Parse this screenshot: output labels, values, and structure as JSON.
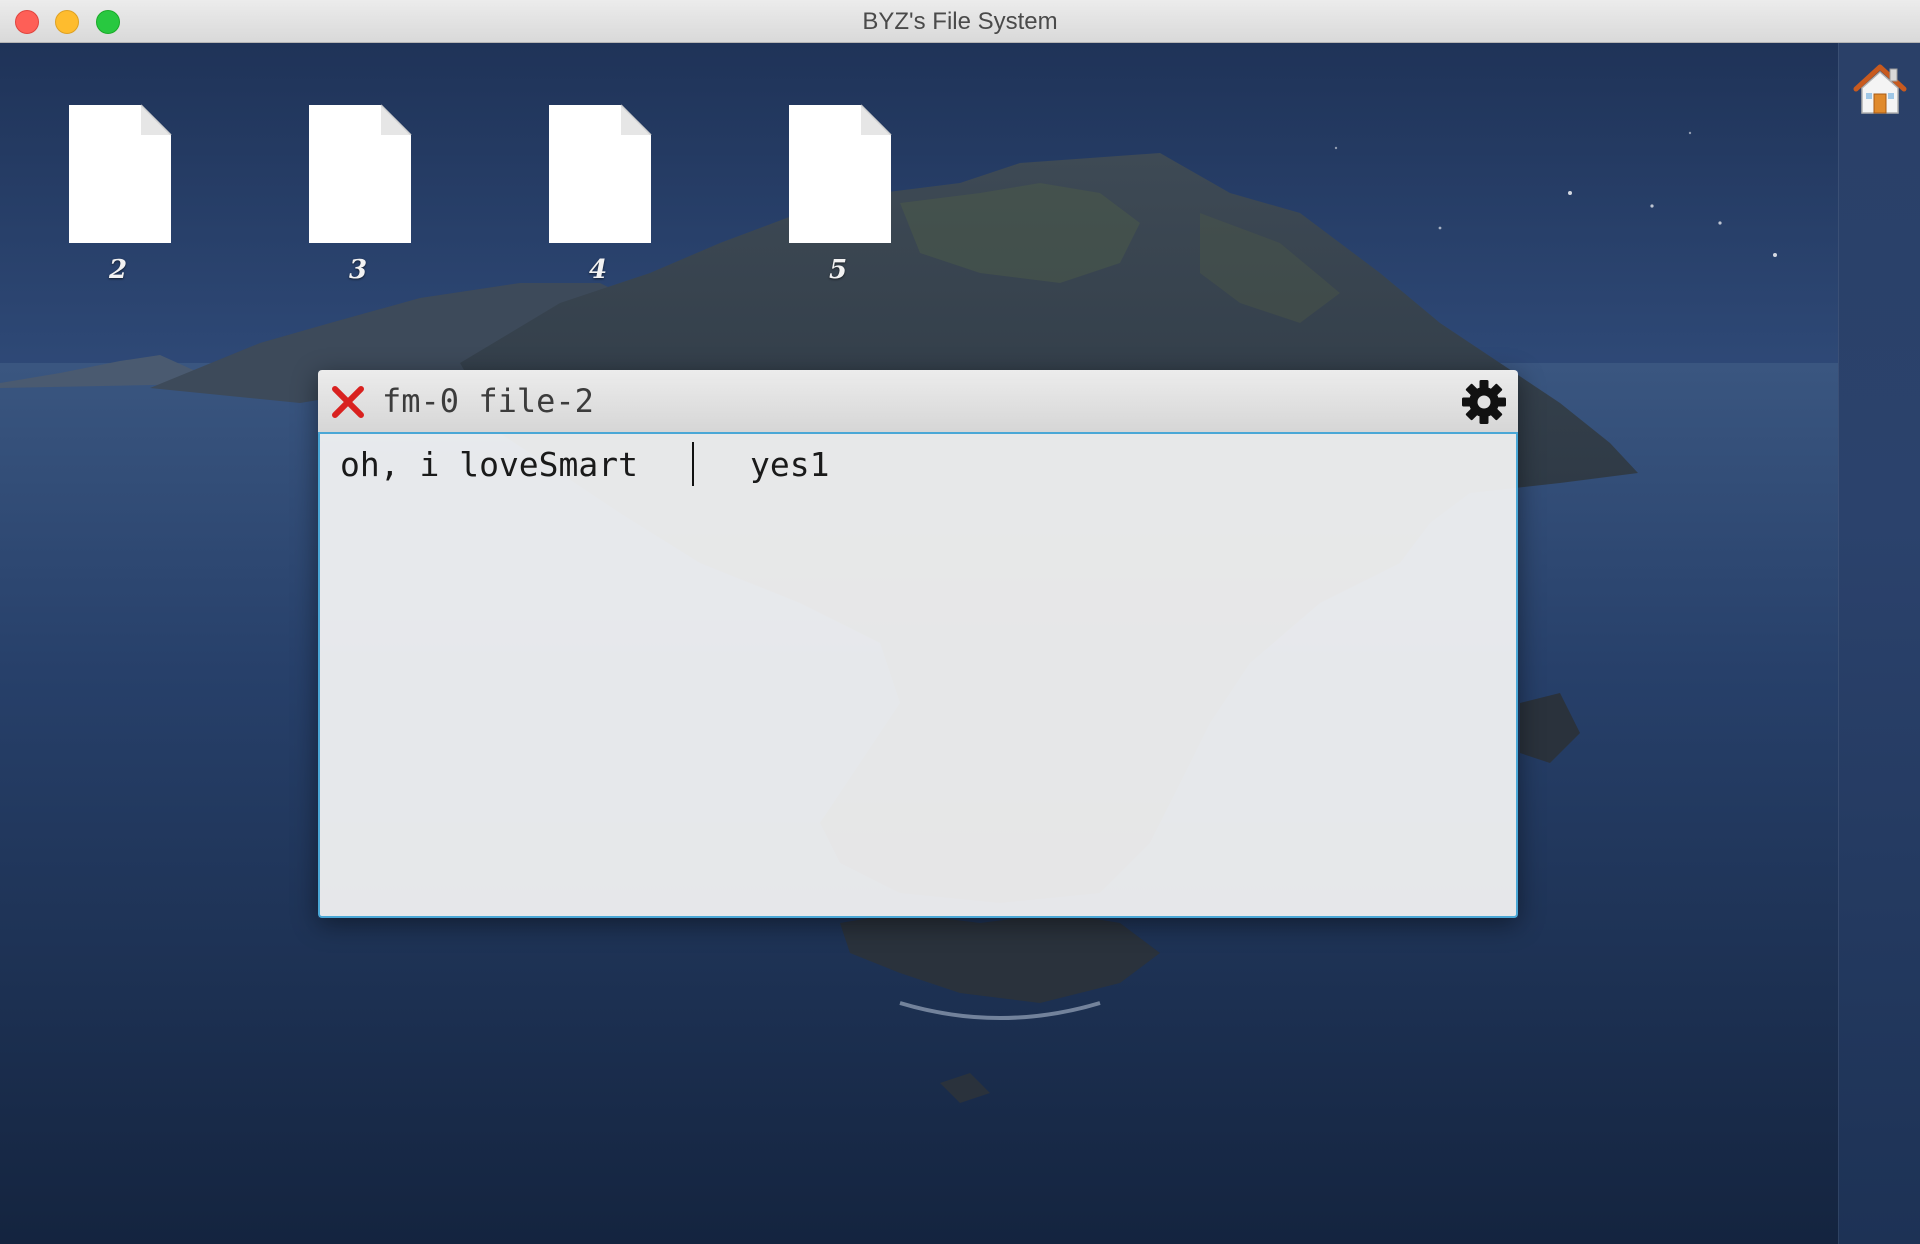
{
  "app": {
    "title": "BYZ's File System"
  },
  "desktop": {
    "files": [
      {
        "label": "2"
      },
      {
        "label": "3"
      },
      {
        "label": "4"
      },
      {
        "label": "5"
      }
    ],
    "home_icon": "home-icon"
  },
  "editor": {
    "title": "fm-0 file-2",
    "close_icon": "close-x-icon",
    "settings_icon": "gear-icon",
    "content_before_cursor": "oh, i loveSmart",
    "content_after_cursor": "yes1"
  },
  "colors": {
    "accent_border": "#4aa7d6",
    "close_red": "#d9211f"
  }
}
